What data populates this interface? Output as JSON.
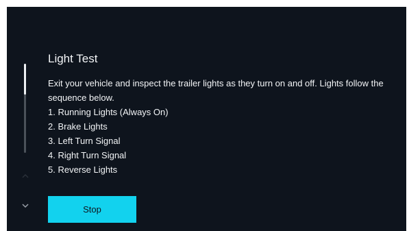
{
  "panel": {
    "title": "Light Test",
    "description": "Exit your vehicle and inspect the trailer lights as they turn on and off. Lights follow the sequence below.",
    "steps": [
      "1. Running Lights (Always On)",
      "2. Brake Lights",
      "3. Left Turn Signal",
      "4. Right Turn Signal",
      "5. Reverse Lights"
    ]
  },
  "buttons": {
    "stop_label": "Stop"
  },
  "scroll": {
    "up_icon": "chevron-up-icon",
    "down_icon": "chevron-down-icon",
    "position": 0.0
  },
  "colors": {
    "background": "#0e141d",
    "accent": "#12d2ee",
    "text": "#f3f5f7"
  }
}
